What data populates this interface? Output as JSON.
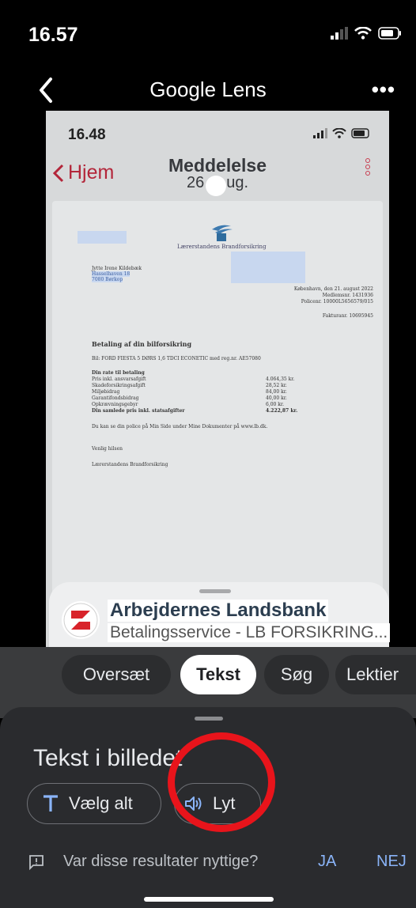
{
  "status_bar": {
    "time": "16.57"
  },
  "lens_header": {
    "title": "Google Lens",
    "more": "•••"
  },
  "photo": {
    "status_time": "16.48",
    "back_label": "Hjem",
    "title": "Meddelelse",
    "date_left": "26",
    "date_right": "ug.",
    "document": {
      "company": "Lærerstandens Brandforsikring",
      "recipient_name": "Jytte Irene Kildebæk",
      "recipient_street": "Hasselhaven 18",
      "recipient_city": "7080 Børkop",
      "place_date": "København, den 21. august 2022",
      "member_no": "Medlemsnr. 1431936",
      "policy_no": "Policenr. 10000L5656579/015",
      "invoice_no": "Fakturanr. 10695945",
      "heading": "Betaling af din bilforsikring",
      "car_line": "Bil: FORD FIESTA 5 DØRS 1,6 TDCI ECONETIC med reg.nr. AE57080",
      "rate_heading": "Din rate til betaling",
      "lines": [
        {
          "label": "Pris inkl. ansvarsafgift",
          "amount": "4.064,35 kr."
        },
        {
          "label": "Skadeforsikringsafgift",
          "amount": "28,52 kr."
        },
        {
          "label": "Miljøbidrag",
          "amount": "84,00 kr."
        },
        {
          "label": "Garantifondsbidrag",
          "amount": "40,00 kr."
        },
        {
          "label": "Opkrævningsgebyr",
          "amount": "6,00 kr."
        }
      ],
      "total_label": "Din samlede pris inkl. statsafgifter",
      "total_amount": "4.222,87 kr.",
      "policy_note": "Du kan se din police på Min Side under Mine Dokumenter på www.lb.dk.",
      "greeting": "Venlig hilsen",
      "signature": "Lærerstandens Brandforsikring"
    }
  },
  "result_card": {
    "title": "Arbejdernes Landsbank",
    "subtitle": "Betalingsservice - LB FORSIKRING..."
  },
  "mode_pills": [
    {
      "label": "Oversæt"
    },
    {
      "label": "Tekst"
    },
    {
      "label": "Søg"
    },
    {
      "label": "Lektier"
    }
  ],
  "text_panel": {
    "title": "Tekst i billedet",
    "select_all": "Vælg alt",
    "listen": "Lyt",
    "feedback_question": "Var disse resultater nyttige?",
    "yes": "JA",
    "no": "NEJ"
  },
  "colors": {
    "accent_red": "#e8141b",
    "link_blue": "#8ab4f8",
    "panel_bg": "#2a2b2e"
  }
}
